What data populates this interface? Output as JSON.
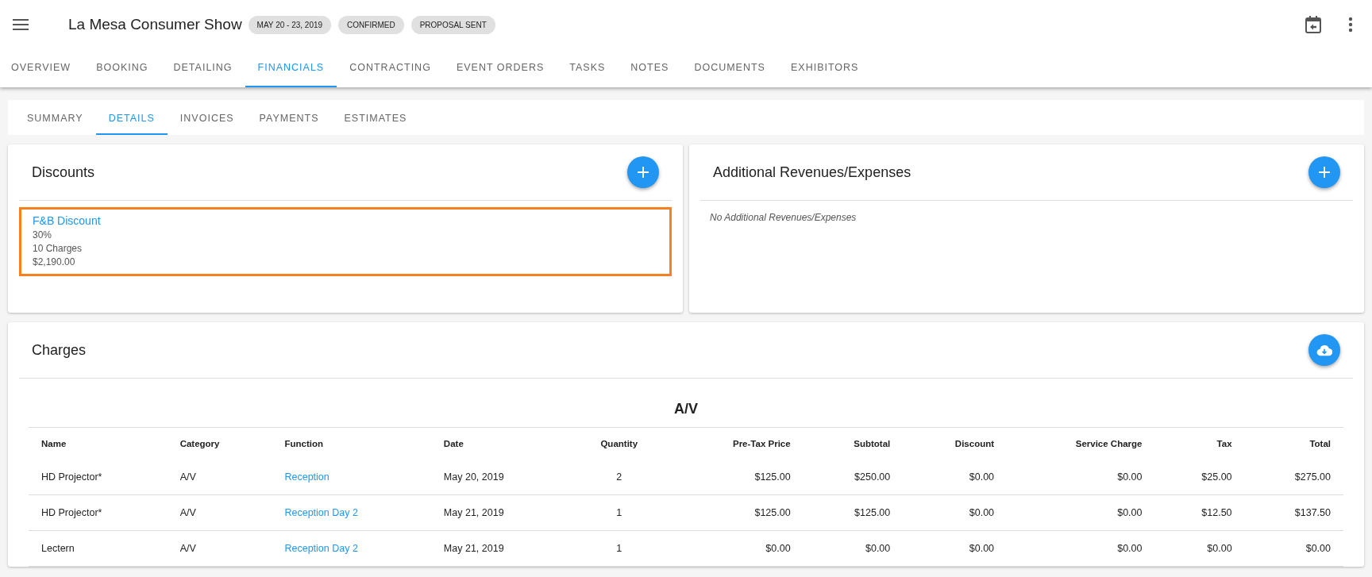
{
  "header": {
    "title": "La Mesa Consumer Show",
    "chips": [
      "MAY 20 - 23, 2019",
      "CONFIRMED",
      "PROPOSAL SENT"
    ]
  },
  "tabs": [
    {
      "label": "OVERVIEW",
      "selected": false
    },
    {
      "label": "BOOKING",
      "selected": false
    },
    {
      "label": "DETAILING",
      "selected": false
    },
    {
      "label": "FINANCIALS",
      "selected": true
    },
    {
      "label": "CONTRACTING",
      "selected": false
    },
    {
      "label": "EVENT ORDERS",
      "selected": false
    },
    {
      "label": "TASKS",
      "selected": false
    },
    {
      "label": "NOTES",
      "selected": false
    },
    {
      "label": "DOCUMENTS",
      "selected": false
    },
    {
      "label": "EXHIBITORS",
      "selected": false
    }
  ],
  "subtabs": [
    {
      "label": "SUMMARY",
      "selected": false
    },
    {
      "label": "DETAILS",
      "selected": true
    },
    {
      "label": "INVOICES",
      "selected": false
    },
    {
      "label": "PAYMENTS",
      "selected": false
    },
    {
      "label": "ESTIMATES",
      "selected": false
    }
  ],
  "discounts": {
    "title": "Discounts",
    "items": [
      {
        "name": "F&B Discount",
        "percent": "30%",
        "charges": "10 Charges",
        "amount": "$2,190.00",
        "selected": true
      }
    ]
  },
  "additional": {
    "title": "Additional Revenues/Expenses",
    "empty": "No Additional Revenues/Expenses"
  },
  "charges": {
    "title": "Charges",
    "group": "A/V",
    "columns": [
      "Name",
      "Category",
      "Function",
      "Date",
      "Quantity",
      "Pre-Tax Price",
      "Subtotal",
      "Discount",
      "Service Charge",
      "Tax",
      "Total"
    ],
    "rows": [
      [
        "HD Projector*",
        "A/V",
        "Reception",
        "May 20, 2019",
        "2",
        "$125.00",
        "$250.00",
        "$0.00",
        "$0.00",
        "$25.00",
        "$275.00"
      ],
      [
        "HD Projector*",
        "A/V",
        "Reception Day 2",
        "May 21, 2019",
        "1",
        "$125.00",
        "$125.00",
        "$0.00",
        "$0.00",
        "$12.50",
        "$137.50"
      ],
      [
        "Lectern",
        "A/V",
        "Reception Day 2",
        "May 21, 2019",
        "1",
        "$0.00",
        "$0.00",
        "$0.00",
        "$0.00",
        "$0.00",
        "$0.00"
      ]
    ]
  }
}
